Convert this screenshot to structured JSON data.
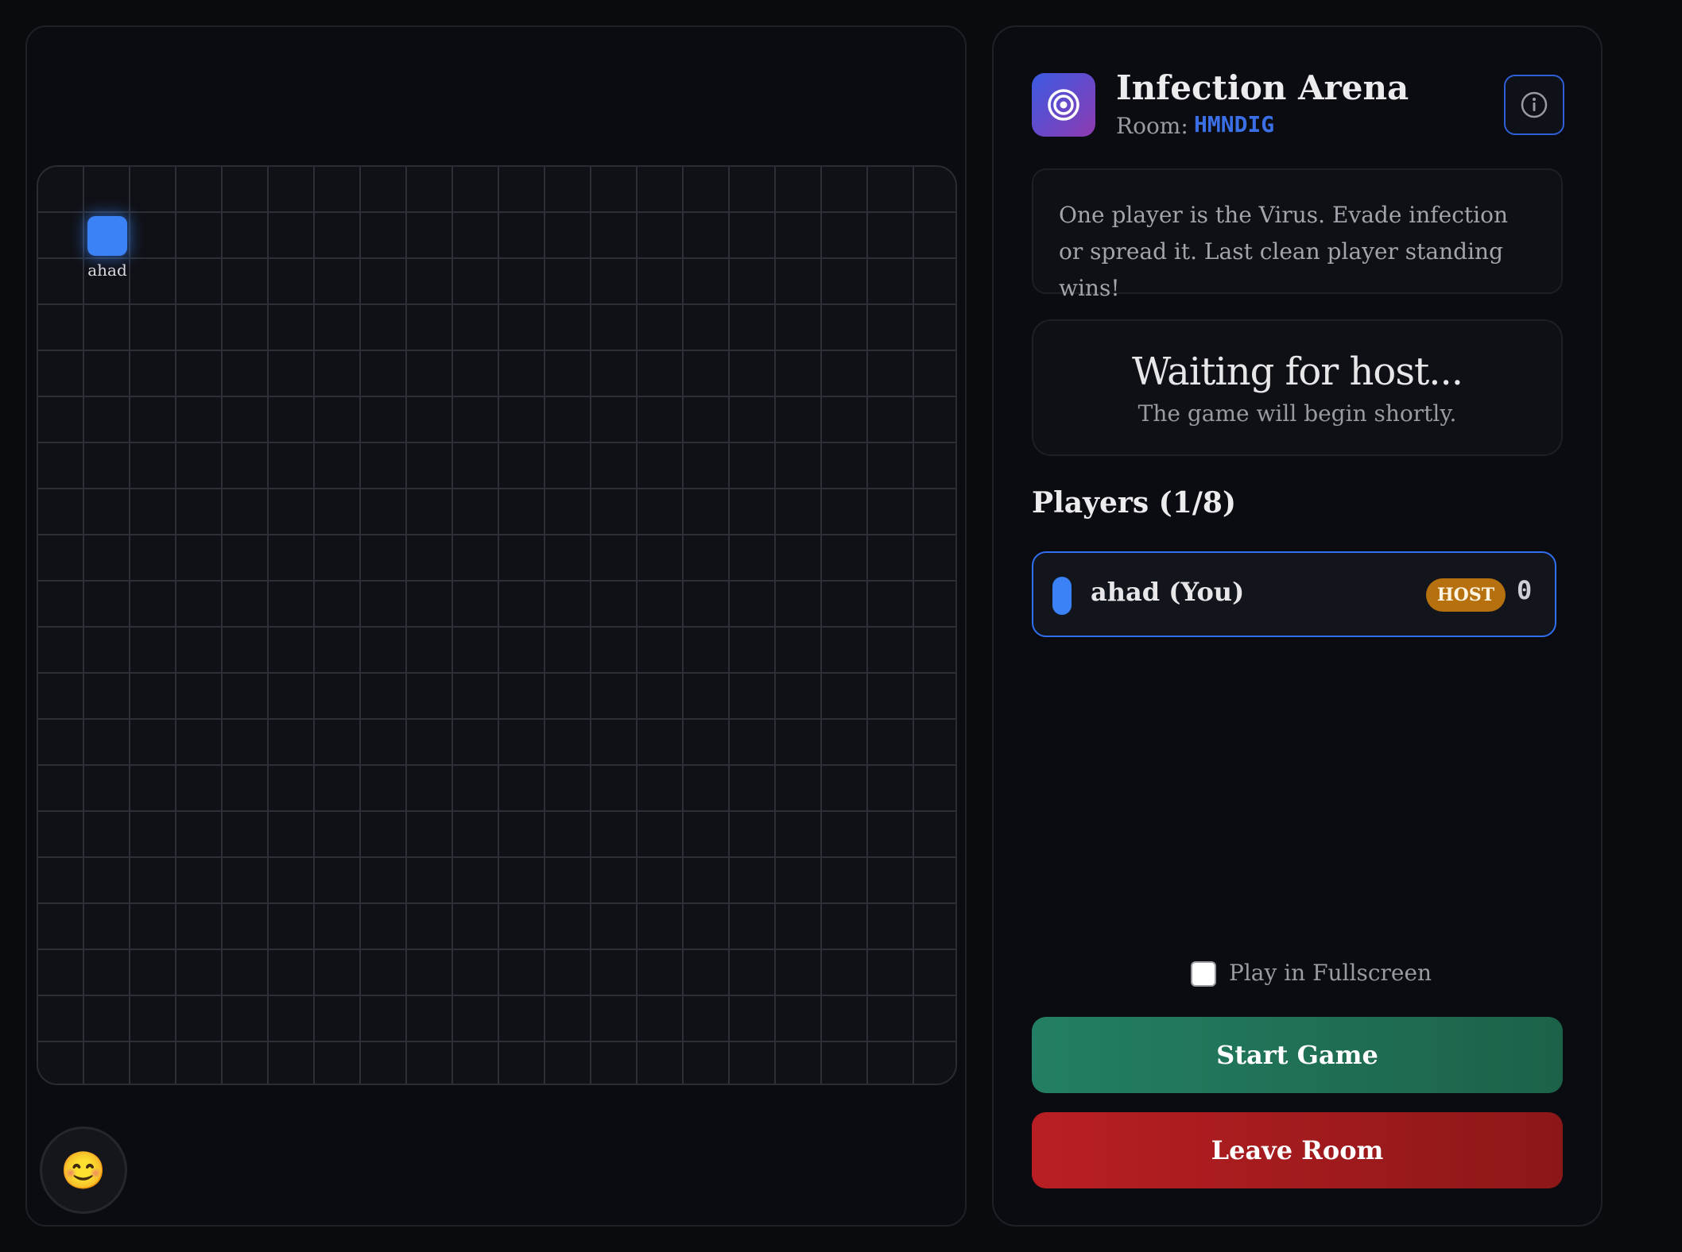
{
  "arena": {
    "player_token": {
      "label": "ahad",
      "color": "#3b82f6",
      "icon": "player-square"
    },
    "emoji_button": {
      "icon": "smiley-emoji",
      "glyph": "😊"
    }
  },
  "header": {
    "logo_icon": "target-icon",
    "title": "Infection Arena",
    "room_label": "Room:",
    "room_code": "HMNDIG",
    "info_icon": "info-icon"
  },
  "description": "One player is the Virus. Evade infection or spread it. Last clean player standing wins!",
  "status": {
    "title": "Waiting for host...",
    "subtitle": "The game will begin shortly."
  },
  "players": {
    "heading": "Players (1/8)",
    "list": [
      {
        "name": "ahad (You)",
        "color": "#3b82f6",
        "badge": "HOST",
        "score": "0"
      }
    ]
  },
  "controls": {
    "fullscreen_label": "Play in Fullscreen",
    "fullscreen_checked": false,
    "start_label": "Start Game",
    "leave_label": "Leave Room"
  },
  "colors": {
    "accent": "#3b6fe6",
    "host_badge": "#b7700e",
    "start": "#237f63",
    "leave": "#b91f22"
  }
}
